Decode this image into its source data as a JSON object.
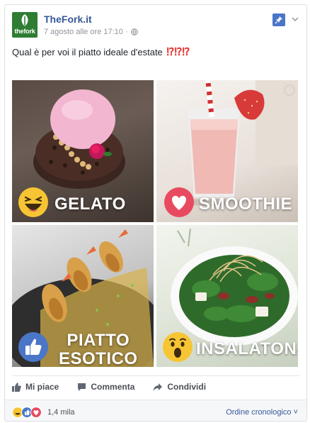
{
  "post": {
    "page_name": "TheFork.it",
    "avatar_word": "thefork",
    "timestamp": "7 agosto alle ore 17:10 ·",
    "text": "Qual è per voi il piatto ideale d'estate",
    "text_emoji": "⁉⁉⁉"
  },
  "tiles": [
    {
      "label_line1": "GELATO",
      "label_line2": "",
      "reaction": "haha-icon"
    },
    {
      "label_line1": "SMOOTHIE",
      "label_line2": "",
      "reaction": "love-icon"
    },
    {
      "label_line1": "PIATTO",
      "label_line2": "ESOTICO",
      "reaction": "like-icon"
    },
    {
      "label_line1": "INSALATONA",
      "label_line2": "",
      "reaction": "wow-icon"
    }
  ],
  "actions": {
    "like": "Mi piace",
    "comment": "Commenta",
    "share": "Condividi"
  },
  "footer": {
    "reaction_count": "1,4 mila",
    "sort": "Ordine cronologico ˅"
  },
  "colors": {
    "link": "#365899",
    "like_blue": "#4a76c8",
    "love_red": "#e84a5f",
    "emoji_yellow": "#f7c533",
    "brand_green": "#2e7d32"
  }
}
